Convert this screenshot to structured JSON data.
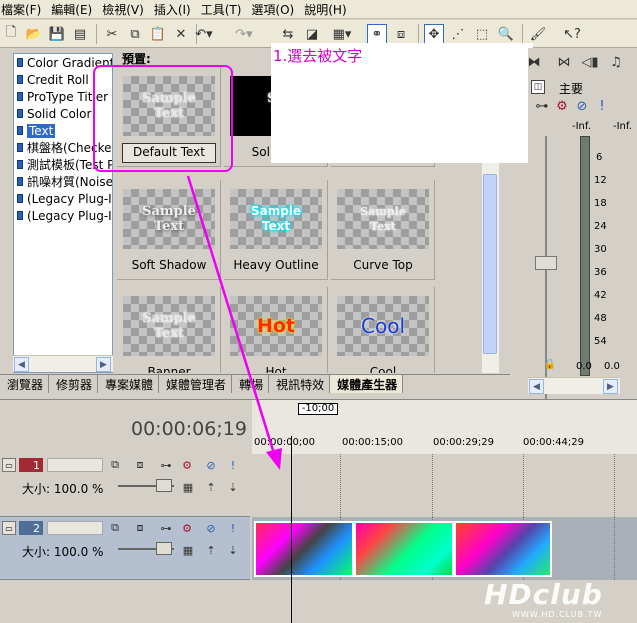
{
  "menu": [
    "檔案(F)",
    "編輯(E)",
    "檢視(V)",
    "插入(I)",
    "工具(T)",
    "選項(O)",
    "說明(H)"
  ],
  "tree": [
    "Color Gradient",
    "Credit Roll",
    "ProType Titler",
    "Solid Color",
    "Text",
    "棋盤格(Checkerl",
    "測試模板(Test P",
    "訊噪材質(Noise",
    "(Legacy Plug-In",
    "(Legacy Plug-In"
  ],
  "preset_label": "預置:",
  "presets": [
    {
      "thumb": "Sample\nText",
      "caption": "Default Text"
    },
    {
      "thumb": "Sa\nT",
      "caption": "Solid Ba"
    },
    {
      "thumb": "",
      "caption": ""
    },
    {
      "thumb": "Sample\nText",
      "caption": "Soft Shadow"
    },
    {
      "thumb": "Sample\nText",
      "caption": "Heavy Outline"
    },
    {
      "thumb": "Sample\nText",
      "caption": "Curve Top"
    },
    {
      "thumb": "Sample\nText",
      "caption": "Banner"
    },
    {
      "thumb": "Hot",
      "caption": "Hot"
    },
    {
      "thumb": "Cool",
      "caption": "Cool"
    }
  ],
  "annotation": "1.選去被文字",
  "mixer": {
    "label": "主要",
    "scale_top": "-Inf.",
    "scale": [
      "6",
      "12",
      "18",
      "24",
      "30",
      "36",
      "42",
      "48",
      "54"
    ],
    "bottom_values": [
      "0.0",
      "0.0"
    ]
  },
  "tabs": [
    "瀏覽器",
    "修剪器",
    "專案媒體",
    "媒體管理者",
    "轉場",
    "視訊特效",
    "媒體產生器"
  ],
  "timecode": "00:00:06;19",
  "loop_region": "-10;00",
  "ruler_times": [
    "00:00:00;00",
    "00:00:15;00",
    "00:00:29;29",
    "00:00:44;29"
  ],
  "tracks": [
    {
      "number": "1",
      "size": "大小: 100.0 %"
    },
    {
      "number": "2",
      "size": "大小: 100.0 %"
    }
  ],
  "watermark": "HDclub",
  "watermark_sub": "WWW.HD.CLUB.TW",
  "colors": {
    "accent": "#316ac5",
    "annotation": "#f000f0",
    "track1": "#a12a35",
    "track2": "#4f6e98"
  }
}
